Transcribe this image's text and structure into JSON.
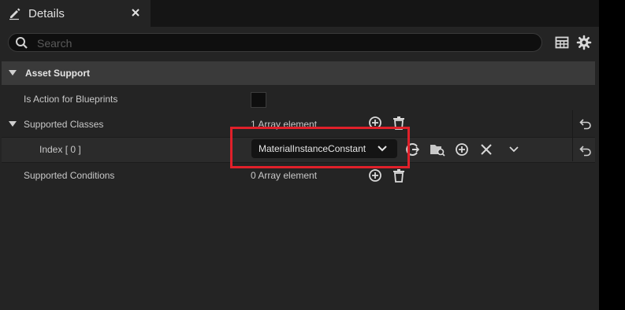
{
  "tab": {
    "title": "Details",
    "icon": "pencil-icon"
  },
  "search": {
    "placeholder": "Search"
  },
  "category": {
    "title": "Asset Support"
  },
  "rows": [
    {
      "label": "Is Action for Blueprints"
    },
    {
      "label": "Supported Classes",
      "value": "1 Array element"
    },
    {
      "label": "Index [ 0 ]",
      "value": "MaterialInstanceConstant"
    },
    {
      "label": "Supported Conditions",
      "value": "0 Array element"
    }
  ],
  "colors": {
    "panel": "#242424",
    "header": "#3a3a3a",
    "highlight": "#e0202a"
  }
}
